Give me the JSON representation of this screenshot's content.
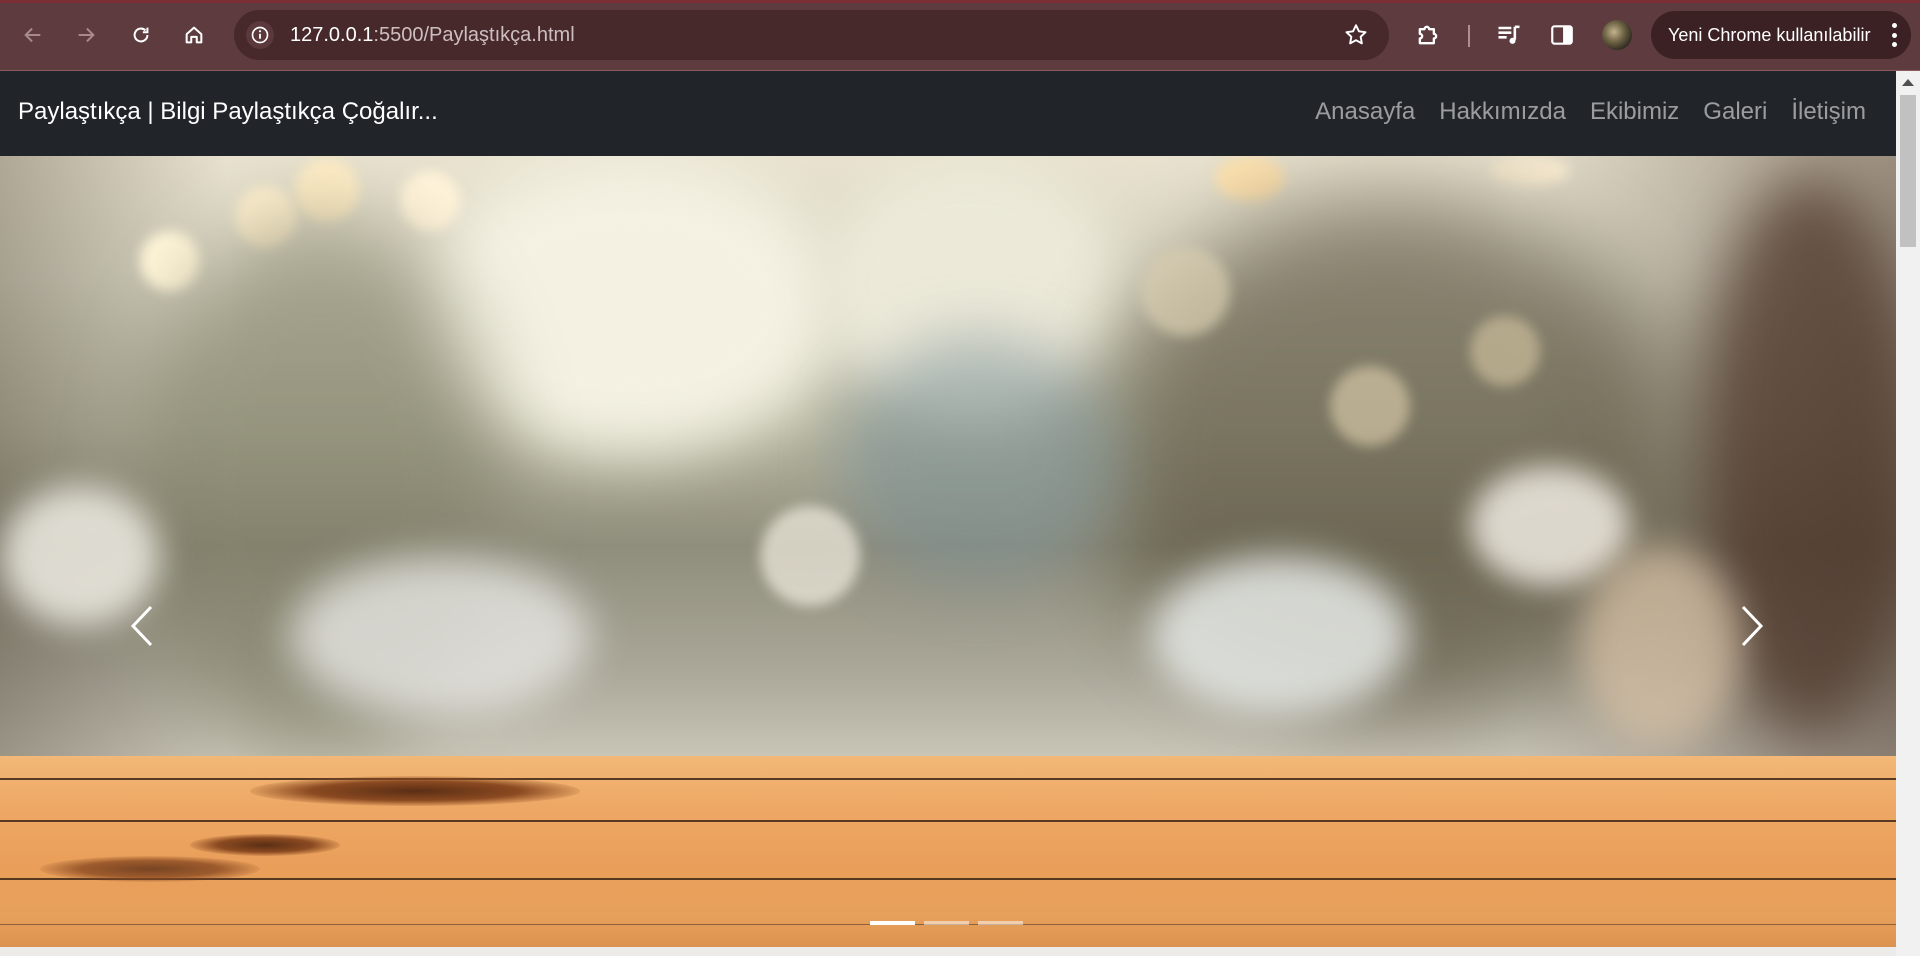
{
  "browser": {
    "url_host": "127.0.0.1",
    "url_rest": ":5500/Paylaştıkça.html",
    "update_label": "Yeni Chrome kullanılabilir",
    "icons": {
      "back": "arrow-left-icon",
      "forward": "arrow-right-icon",
      "reload": "reload-icon",
      "home": "home-icon",
      "site_info": "info-icon",
      "bookmark": "star-icon",
      "extensions": "puzzle-icon",
      "media": "media-playlist-icon",
      "side_panel": "side-panel-icon",
      "profile": "avatar",
      "menu": "kebab-menu-icon"
    },
    "colors": {
      "frame": "#5d3b3e",
      "omnibox": "#47292c",
      "pill": "#3b2124"
    }
  },
  "site": {
    "brand": "Paylaştıkça | Bilgi Paylaştıkça Çoğalır...",
    "nav": [
      {
        "label": "Anasayfa"
      },
      {
        "label": "Hakkımızda"
      },
      {
        "label": "Ekibimiz"
      },
      {
        "label": "Galeri"
      },
      {
        "label": "İletişim"
      }
    ],
    "colors": {
      "navbar": "#212529",
      "nav_link": "rgba(255,255,255,0.55)"
    }
  },
  "carousel": {
    "slide_count": 3,
    "active_index": 0,
    "image": "blurred bokeh cafe background above wooden tabletop",
    "prev_icon": "chevron-left-icon",
    "next_icon": "chevron-right-icon"
  }
}
